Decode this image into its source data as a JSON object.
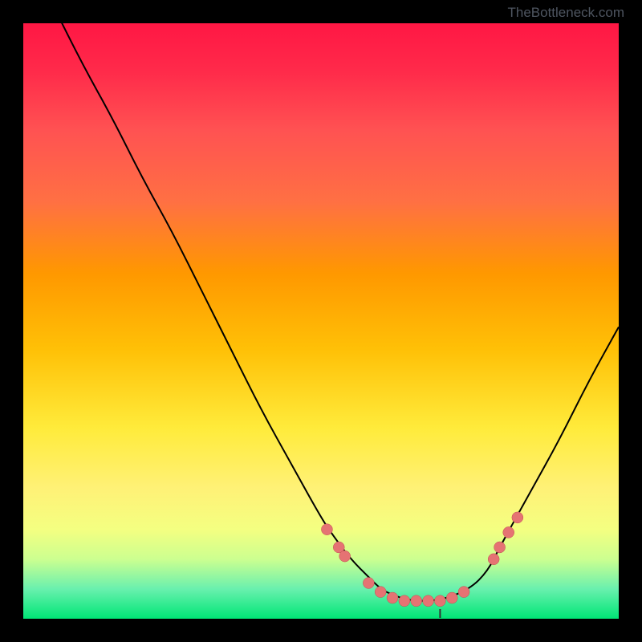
{
  "watermark": "TheBottleneck.com",
  "colors": {
    "background": "#000000",
    "curve": "#000000",
    "marker_fill": "#e57373",
    "marker_stroke": "#c05050",
    "tick": "#333333"
  },
  "chart_data": {
    "type": "line",
    "title": "",
    "xlabel": "",
    "ylabel": "",
    "xlim": [
      0,
      100
    ],
    "ylim": [
      0,
      100
    ],
    "grid": false,
    "legend": false,
    "note": "Axes have no visible numeric tick labels; values are in percent of the plot area estimated from pixel positions.",
    "series": [
      {
        "name": "bottleneck-curve",
        "x": [
          0,
          5,
          10,
          15,
          20,
          25,
          30,
          35,
          40,
          45,
          50,
          52,
          55,
          58,
          60,
          62,
          65,
          70,
          75,
          78,
          80,
          85,
          90,
          95,
          100
        ],
        "y": [
          113,
          103,
          93,
          84,
          74,
          65,
          55,
          45,
          35,
          26,
          17,
          14,
          10,
          7,
          5,
          4,
          3,
          3,
          5,
          8,
          12,
          21,
          30,
          40,
          49
        ]
      }
    ],
    "markers": [
      {
        "x": 51,
        "y": 15
      },
      {
        "x": 53,
        "y": 12
      },
      {
        "x": 54,
        "y": 10.5
      },
      {
        "x": 58,
        "y": 6
      },
      {
        "x": 60,
        "y": 4.5
      },
      {
        "x": 62,
        "y": 3.5
      },
      {
        "x": 64,
        "y": 3
      },
      {
        "x": 66,
        "y": 3
      },
      {
        "x": 68,
        "y": 3
      },
      {
        "x": 70,
        "y": 3
      },
      {
        "x": 72,
        "y": 3.5
      },
      {
        "x": 74,
        "y": 4.5
      },
      {
        "x": 79,
        "y": 10
      },
      {
        "x": 80,
        "y": 12
      },
      {
        "x": 81.5,
        "y": 14.5
      },
      {
        "x": 83,
        "y": 17
      }
    ],
    "center_tick_x": 70
  }
}
